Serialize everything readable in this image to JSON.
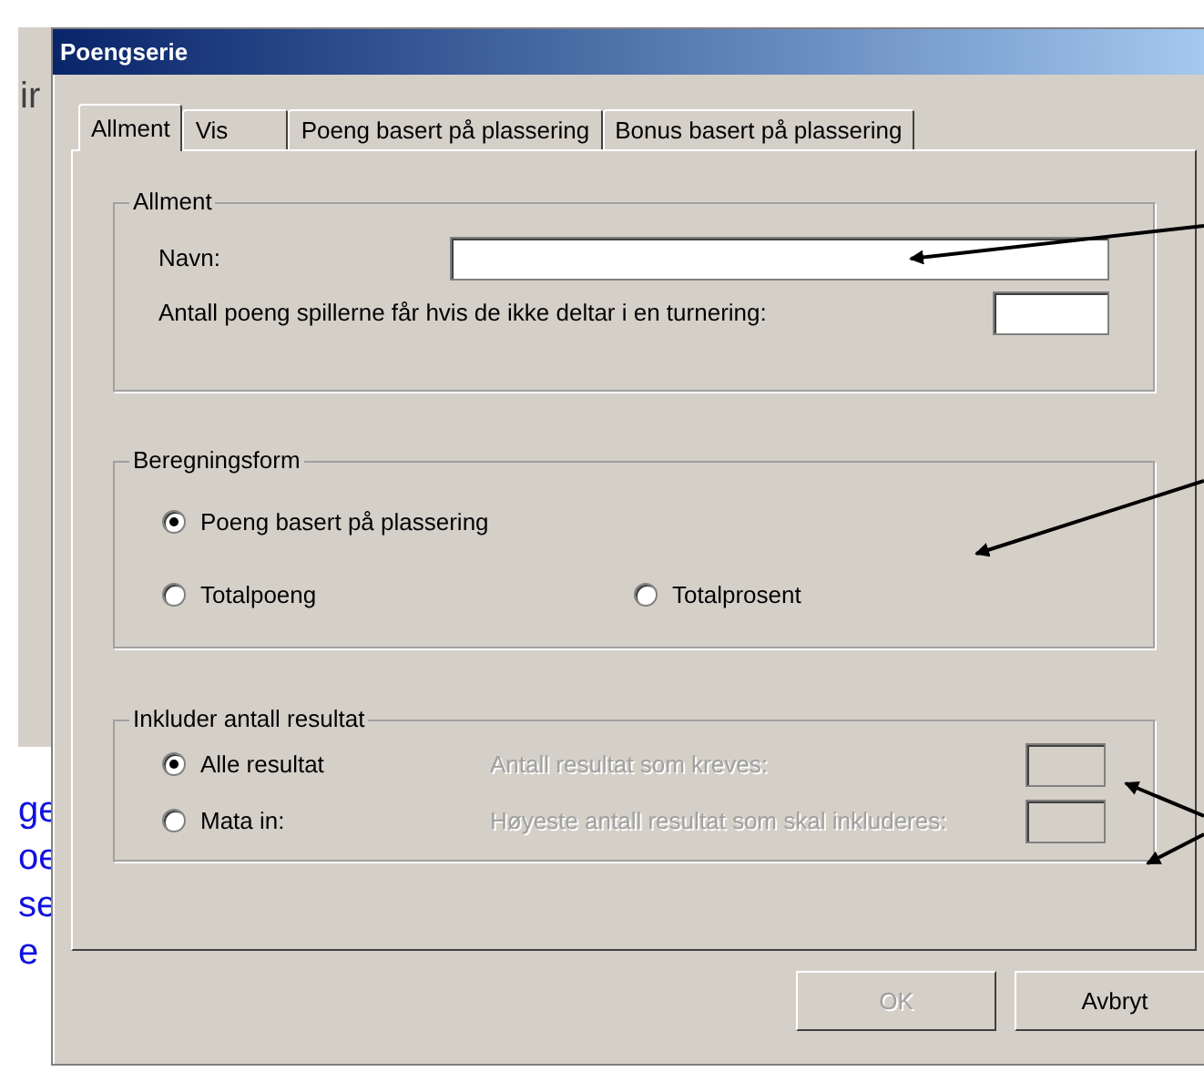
{
  "background_text": [
    "ir",
    "ge",
    "oe",
    "se",
    "e"
  ],
  "window": {
    "title": "Poengserie"
  },
  "tabs": [
    {
      "label": "Allment",
      "selected": true
    },
    {
      "label": "Vis",
      "selected": false
    },
    {
      "label": "Poeng basert på plassering",
      "selected": false
    },
    {
      "label": "Bonus basert på plassering",
      "selected": false
    }
  ],
  "general": {
    "title": "Allment",
    "name_label": "Navn:",
    "absent_points_label": "Antall poeng spillerne får hvis de ikke deltar i en turnering:"
  },
  "calculation": {
    "title": "Beregningsform",
    "options": [
      {
        "label": "Poeng basert på plassering",
        "selected": true
      },
      {
        "label": "Totalpoeng",
        "selected": false
      },
      {
        "label": "Totalprosent",
        "selected": false
      }
    ]
  },
  "include": {
    "title": "Inkluder antall resultat",
    "rows": [
      {
        "option": "Alle resultat",
        "selected": true,
        "field_label": "Antall resultat som kreves:",
        "disabled": true
      },
      {
        "option": "Mata in:",
        "selected": false,
        "field_label": "Høyeste antall resultat som skal inkluderes:",
        "disabled": true
      }
    ]
  },
  "buttons": [
    {
      "label": "OK",
      "disabled": true
    },
    {
      "label": "Avbryt",
      "disabled": false
    }
  ]
}
